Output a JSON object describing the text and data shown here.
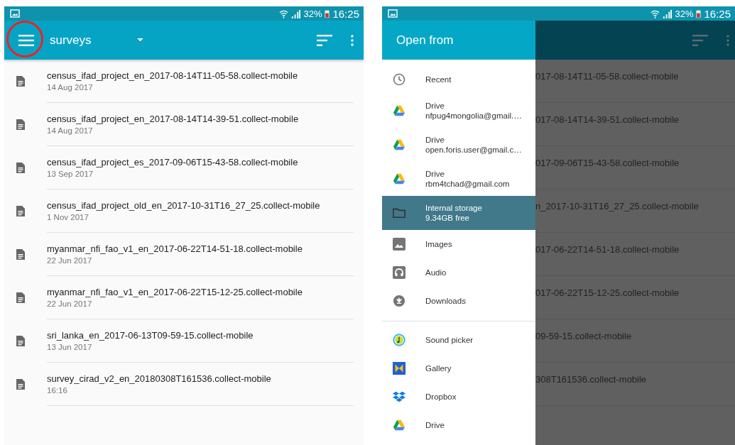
{
  "left_screen": {
    "status_bar": {
      "battery": "32%",
      "time": "16:25"
    },
    "app_bar": {
      "title": "surveys"
    },
    "files": [
      {
        "name": "census_ifad_project_en_2017-08-14T11-05-58.collect-mobile",
        "date": "14 Aug 2017"
      },
      {
        "name": "census_ifad_project_en_2017-08-14T14-39-51.collect-mobile",
        "date": "14 Aug 2017"
      },
      {
        "name": "census_ifad_project_es_2017-09-06T15-43-58.collect-mobile",
        "date": "13 Sep 2017"
      },
      {
        "name": "census_ifad_project_old_en_2017-10-31T16_27_25.collect-mobile",
        "date": "1 Nov 2017"
      },
      {
        "name": "myanmar_nfi_fao_v1_en_2017-06-22T14-51-18.collect-mobile",
        "date": "22 Jun 2017"
      },
      {
        "name": "myanmar_nfi_fao_v1_en_2017-06-22T15-12-25.collect-mobile",
        "date": "22 Jun 2017"
      },
      {
        "name": "sri_lanka_en_2017-06-13T09-59-15.collect-mobile",
        "date": "13 Jun 2017"
      },
      {
        "name": "survey_cirad_v2_en_20180308T161536.collect-mobile",
        "date": "16:16"
      }
    ]
  },
  "right_screen": {
    "status_bar": {
      "battery": "32%",
      "time": "16:25"
    },
    "drawer": {
      "title": "Open from",
      "roots": [
        {
          "kind": "recent",
          "label": "Recent",
          "selected": false
        },
        {
          "kind": "drive",
          "label": "Drive",
          "detail": "nfpug4mongolia@gmail.…",
          "selected": false
        },
        {
          "kind": "drive",
          "label": "Drive",
          "detail": "open.foris.user@gmail.c…",
          "selected": false
        },
        {
          "kind": "drive",
          "label": "Drive",
          "detail": "rbm4tchad@gmail.com",
          "selected": false
        },
        {
          "kind": "storage",
          "label": "Internal storage",
          "detail": "9.34GB free",
          "selected": true
        },
        {
          "kind": "images",
          "label": "Images",
          "selected": false
        },
        {
          "kind": "audio",
          "label": "Audio",
          "selected": false
        },
        {
          "kind": "downloads",
          "label": "Downloads",
          "selected": false
        }
      ],
      "apps": [
        {
          "kind": "sound",
          "label": "Sound picker"
        },
        {
          "kind": "gallery",
          "label": "Gallery"
        },
        {
          "kind": "dropbox",
          "label": "Dropbox"
        },
        {
          "kind": "drive",
          "label": "Drive"
        }
      ]
    },
    "background_rows": [
      "017-08-14T11-05-58.collect-mobile",
      "017-08-14T14-39-51.collect-mobile",
      "017-09-06T15-43-58.collect-mobile",
      "n_2017-10-31T16_27_25.collect-mobile",
      "017-06-22T14-51-18.collect-mobile",
      "017-06-22T15-12-25.collect-mobile",
      "09-59-15.collect-mobile",
      "308T161536.collect-mobile"
    ]
  }
}
